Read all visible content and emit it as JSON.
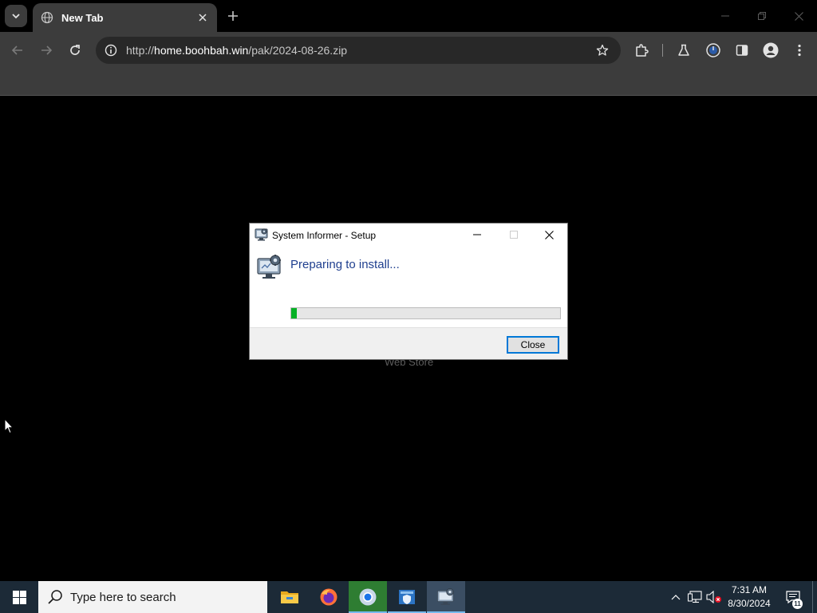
{
  "browser": {
    "tab": {
      "title": "New Tab"
    },
    "address": {
      "url_prefix": "http://",
      "url_host": "home.boohbah.win",
      "url_path": "/pak/2024-08-26.zip"
    },
    "page": {
      "webstore_label": "Web Store"
    }
  },
  "dialog": {
    "title": "System Informer - Setup",
    "heading": "Preparing to install...",
    "progress_percent": 2,
    "close_label": "Close"
  },
  "taskbar": {
    "search_placeholder": "Type here to search",
    "clock_time": "7:31 AM",
    "clock_date": "8/30/2024",
    "notification_count": "11",
    "apps": [
      "file-explorer",
      "firefox",
      "chrome",
      "defender",
      "system-informer-setup"
    ]
  },
  "colors": {
    "accent_blue": "#0078d7",
    "progress_green": "#06b025",
    "taskbar_bg": "#1c2a37",
    "chrome_toolbar": "#3c3c3c"
  }
}
